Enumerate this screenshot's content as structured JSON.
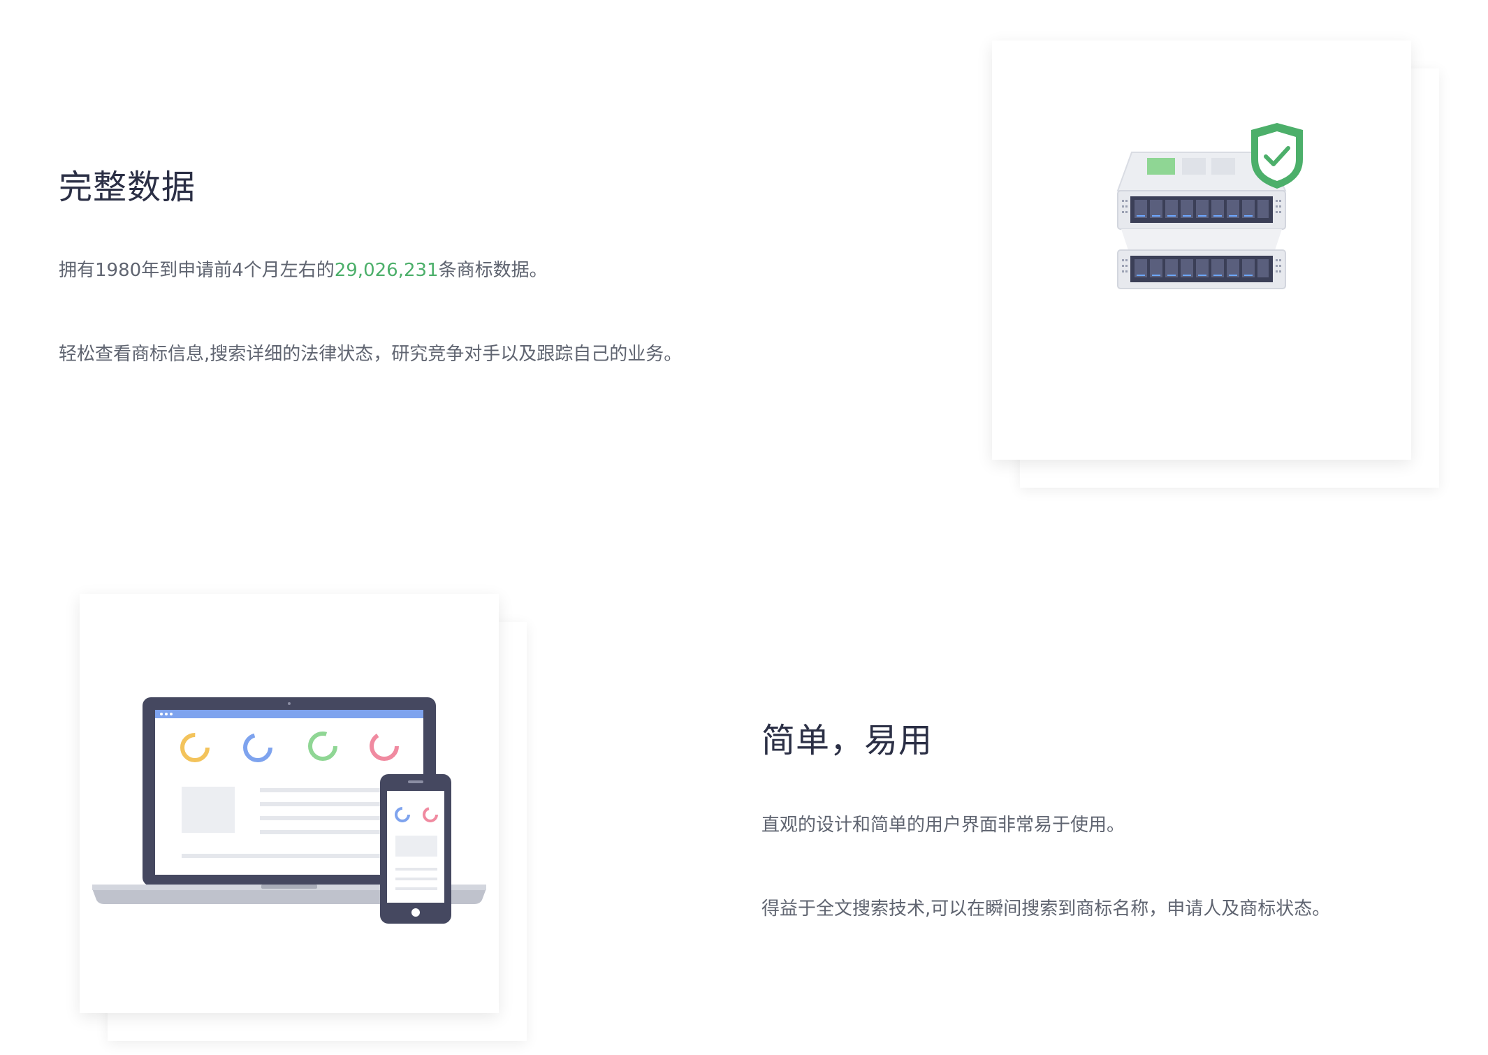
{
  "section_complete_data": {
    "title": "完整数据",
    "para1_prefix": "拥有1980年到申请前4个月左右的",
    "para1_highlight": "29,026,231",
    "para1_suffix": "条商标数据。",
    "para2": "轻松查看商标信息,搜索详细的法律状态，研究竞争对手以及跟踪自己的业务。",
    "illustration_icon": "server-shield-icon"
  },
  "section_easy_use": {
    "title": "简单，易用",
    "para1": "直观的设计和简单的用户界面非常易于使用。",
    "para2": "得益于全文搜索技术,可以在瞬间搜索到商标名称，申请人及商标状态。",
    "illustration_icon": "laptop-phone-icon"
  },
  "colors": {
    "heading": "#2b2f45",
    "body_text": "#5f6470",
    "highlight": "#4caf6a",
    "shield": "#4caf6a",
    "server_bay": "#3b3f57",
    "laptop_frame": "#454860"
  }
}
